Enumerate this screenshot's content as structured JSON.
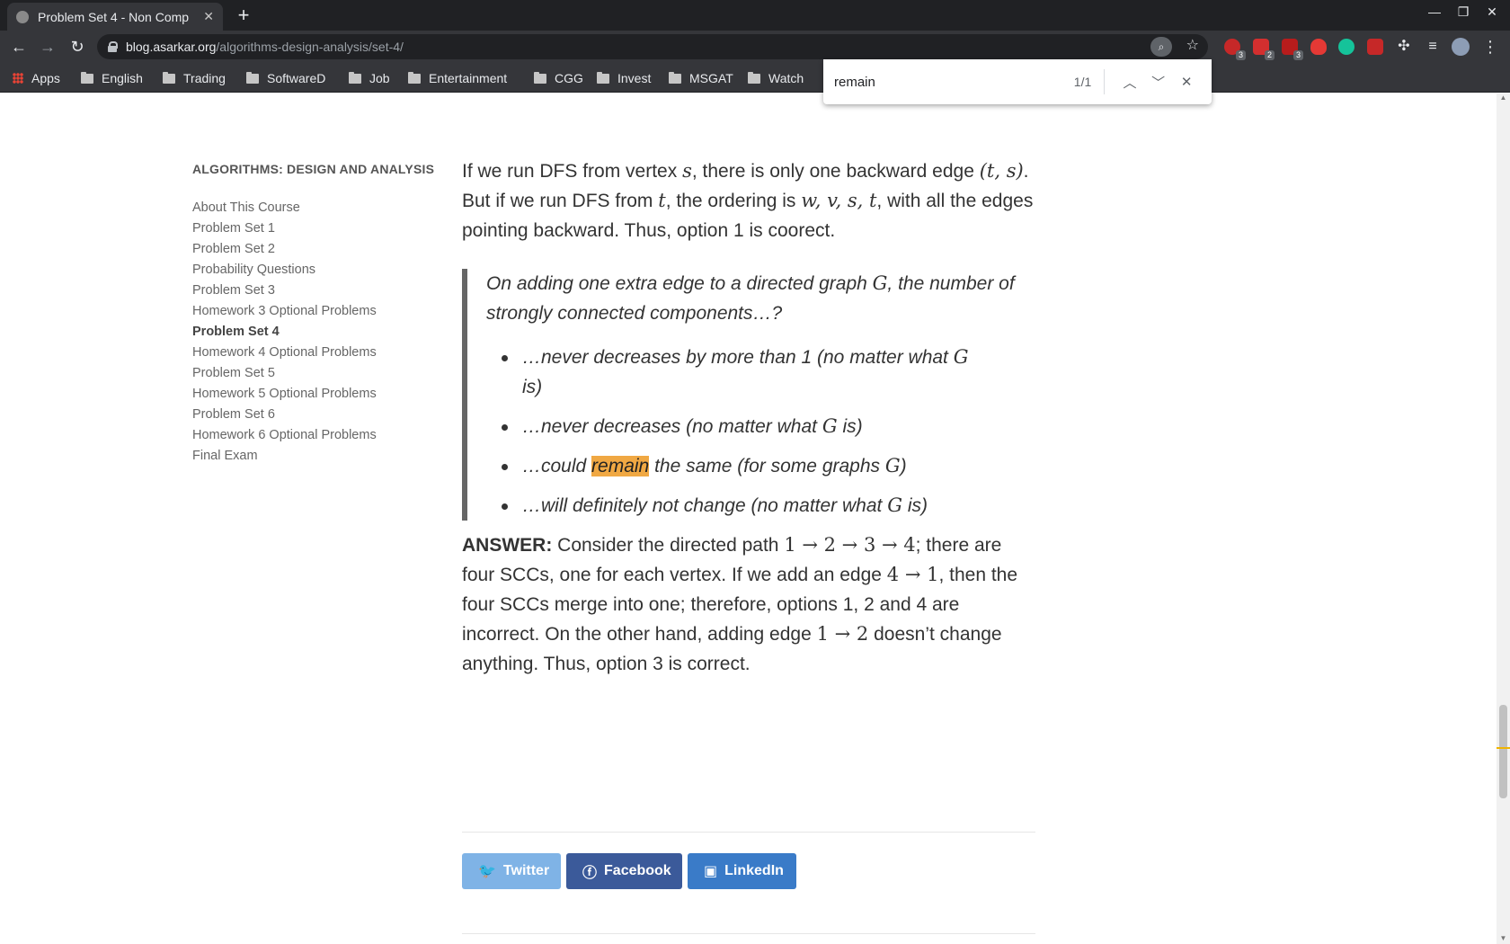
{
  "browser": {
    "tab_title": "Problem Set 4 - Non Comp",
    "url_domain": "blog.asarkar.org",
    "url_path": "/algorithms-design-analysis/set-4/",
    "extension_badges": [
      "3",
      "2",
      "3"
    ],
    "bookmarks": [
      "Apps",
      "English",
      "Trading",
      "SoftwareD",
      "Job",
      "Entertainment",
      "CGG",
      "Invest",
      "MSGAT",
      "Watch"
    ]
  },
  "find": {
    "query": "remain",
    "count": "1/1"
  },
  "sidebar": {
    "heading": "ALGORITHMS: DESIGN AND ANALYSIS",
    "items": [
      "About This Course",
      "Problem Set 1",
      "Problem Set 2",
      "Probability Questions",
      "Problem Set 3",
      "Homework 3 Optional Problems",
      "Problem Set 4",
      "Homework 4 Optional Problems",
      "Problem Set 5",
      "Homework 5 Optional Problems",
      "Problem Set 6",
      "Homework 6 Optional Problems",
      "Final Exam"
    ],
    "active_index": 6
  },
  "article": {
    "p1": {
      "t1": "If we run DFS from vertex ",
      "m1": "s",
      "t2": ", there is only one backward edge ",
      "m2": "(t, s)",
      "t3": ". But if we run DFS from ",
      "m3": "t",
      "t4": ", the ordering is ",
      "m4": "w, v, s, t",
      "t5": ", with all the edges pointing backward. Thus, option 1 is coorect."
    },
    "question": {
      "t1": "On adding one extra edge to a directed graph ",
      "m1": "G",
      "t2": ", the number of strongly connected components…?"
    },
    "options": {
      "o1a": "…never decreases by more than 1 (no matter what ",
      "o1m": "G",
      "o1b": " is)",
      "o2a": "…never decreases (no matter what ",
      "o2m": "G",
      "o2b": " is)",
      "o3a": "…could ",
      "o3h": "remain",
      "o3b": " the same (for some graphs ",
      "o3m": "G",
      "o3c": ")",
      "o4a": "…will definitely not change (no matter what ",
      "o4m": "G",
      "o4b": " is)"
    },
    "answer": {
      "label": "ANSWER:",
      "t1": " Consider the directed path ",
      "m1": "1 → 2 → 3 → 4",
      "t2": "; there are four SCCs, one for each vertex. If we add an edge ",
      "m2": "4 → 1",
      "t3": ", then the four SCCs merge into one; therefore, options 1, 2 and 4 are incorrect. On the other hand, adding edge ",
      "m3": "1 → 2",
      "t4": " doesn’t change anything. Thus, option 3 is correct."
    }
  },
  "share": {
    "twitter": "Twitter",
    "facebook": "Facebook",
    "linkedin": "LinkedIn"
  },
  "colors": {
    "find_highlight": "#f0a843",
    "twitter": "#7fb3e6",
    "facebook": "#3b5a9a",
    "linkedin": "#3a7bc8"
  }
}
